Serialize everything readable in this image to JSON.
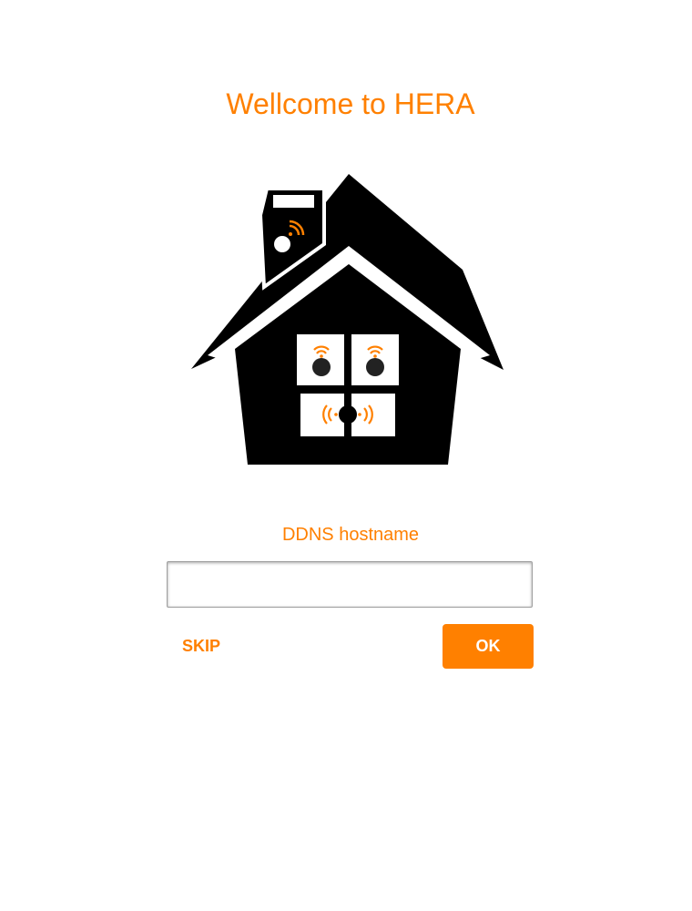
{
  "header": {
    "title": "Wellcome to HERA"
  },
  "logo": {
    "icon": "smart-home-house-icon",
    "colors": {
      "house": "#000000",
      "signal": "#ff8000",
      "window": "#ffffff"
    }
  },
  "form": {
    "label": "DDNS hostname",
    "hostname_value": "",
    "hostname_placeholder": ""
  },
  "actions": {
    "skip_label": "SKIP",
    "ok_label": "OK"
  },
  "theme": {
    "accent": "#ff8000",
    "background": "#ffffff"
  }
}
